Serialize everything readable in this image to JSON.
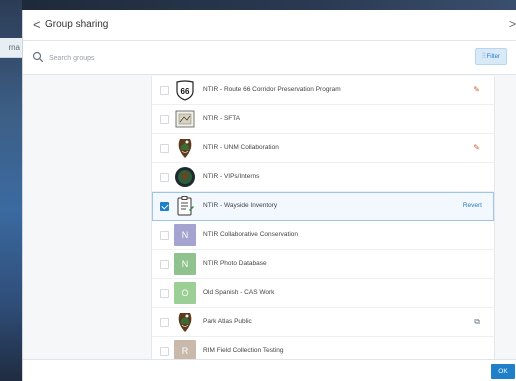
{
  "background": {
    "partial_label": "rna"
  },
  "header": {
    "back_glyph": "<",
    "title": "Group sharing",
    "close_glyph": ">"
  },
  "search": {
    "placeholder": "Search groups",
    "value": ""
  },
  "filter": {
    "label": "Filter",
    "icon": "filter-icon"
  },
  "groups": [
    {
      "name": "NTIR - Route 66 Corridor Preservation Program",
      "checked": false,
      "thumb": "route-66-shield-icon",
      "action": "edit",
      "action_icon": "pencil-icon"
    },
    {
      "name": "NTIR - SFTA",
      "checked": false,
      "thumb": "sfta-logo-icon",
      "action": "",
      "action_icon": ""
    },
    {
      "name": "NTIR - UNM Collaboration",
      "checked": false,
      "thumb": "nps-arrowhead-icon",
      "action": "edit",
      "action_icon": "pencil-icon"
    },
    {
      "name": "NTIR - VIPs/Interns",
      "checked": false,
      "thumb": "vip-badge-icon",
      "action": "",
      "action_icon": ""
    },
    {
      "name": "NTIR - Wayside Inventory",
      "checked": true,
      "thumb": "clipboard-icon",
      "action": "Revert",
      "action_icon": ""
    },
    {
      "name": "NTIR Collaborative Conservation",
      "checked": false,
      "thumb_letter": "N",
      "thumb_color": "#a5a3cf",
      "action": "",
      "action_icon": ""
    },
    {
      "name": "NTIR Photo Database",
      "checked": false,
      "thumb_letter": "N",
      "thumb_color": "#8fc28e",
      "action": "",
      "action_icon": ""
    },
    {
      "name": "Old Spanish - CAS Work",
      "checked": false,
      "thumb_letter": "O",
      "thumb_color": "#9ccf95",
      "action": "",
      "action_icon": ""
    },
    {
      "name": "Park Atlas Public",
      "checked": false,
      "thumb": "nps-arrowhead-icon",
      "action": "",
      "action_icon": "shared-icon"
    },
    {
      "name": "RIM Field Collection Testing",
      "checked": false,
      "thumb_letter": "R",
      "thumb_color": "#c8b9aa",
      "action": "",
      "action_icon": ""
    }
  ],
  "footer": {
    "ok_label": "OK"
  },
  "colors": {
    "accent": "#1f7fc8",
    "edit_icon": "#d2632f",
    "selected_row_bg": "#f2f8fd"
  }
}
